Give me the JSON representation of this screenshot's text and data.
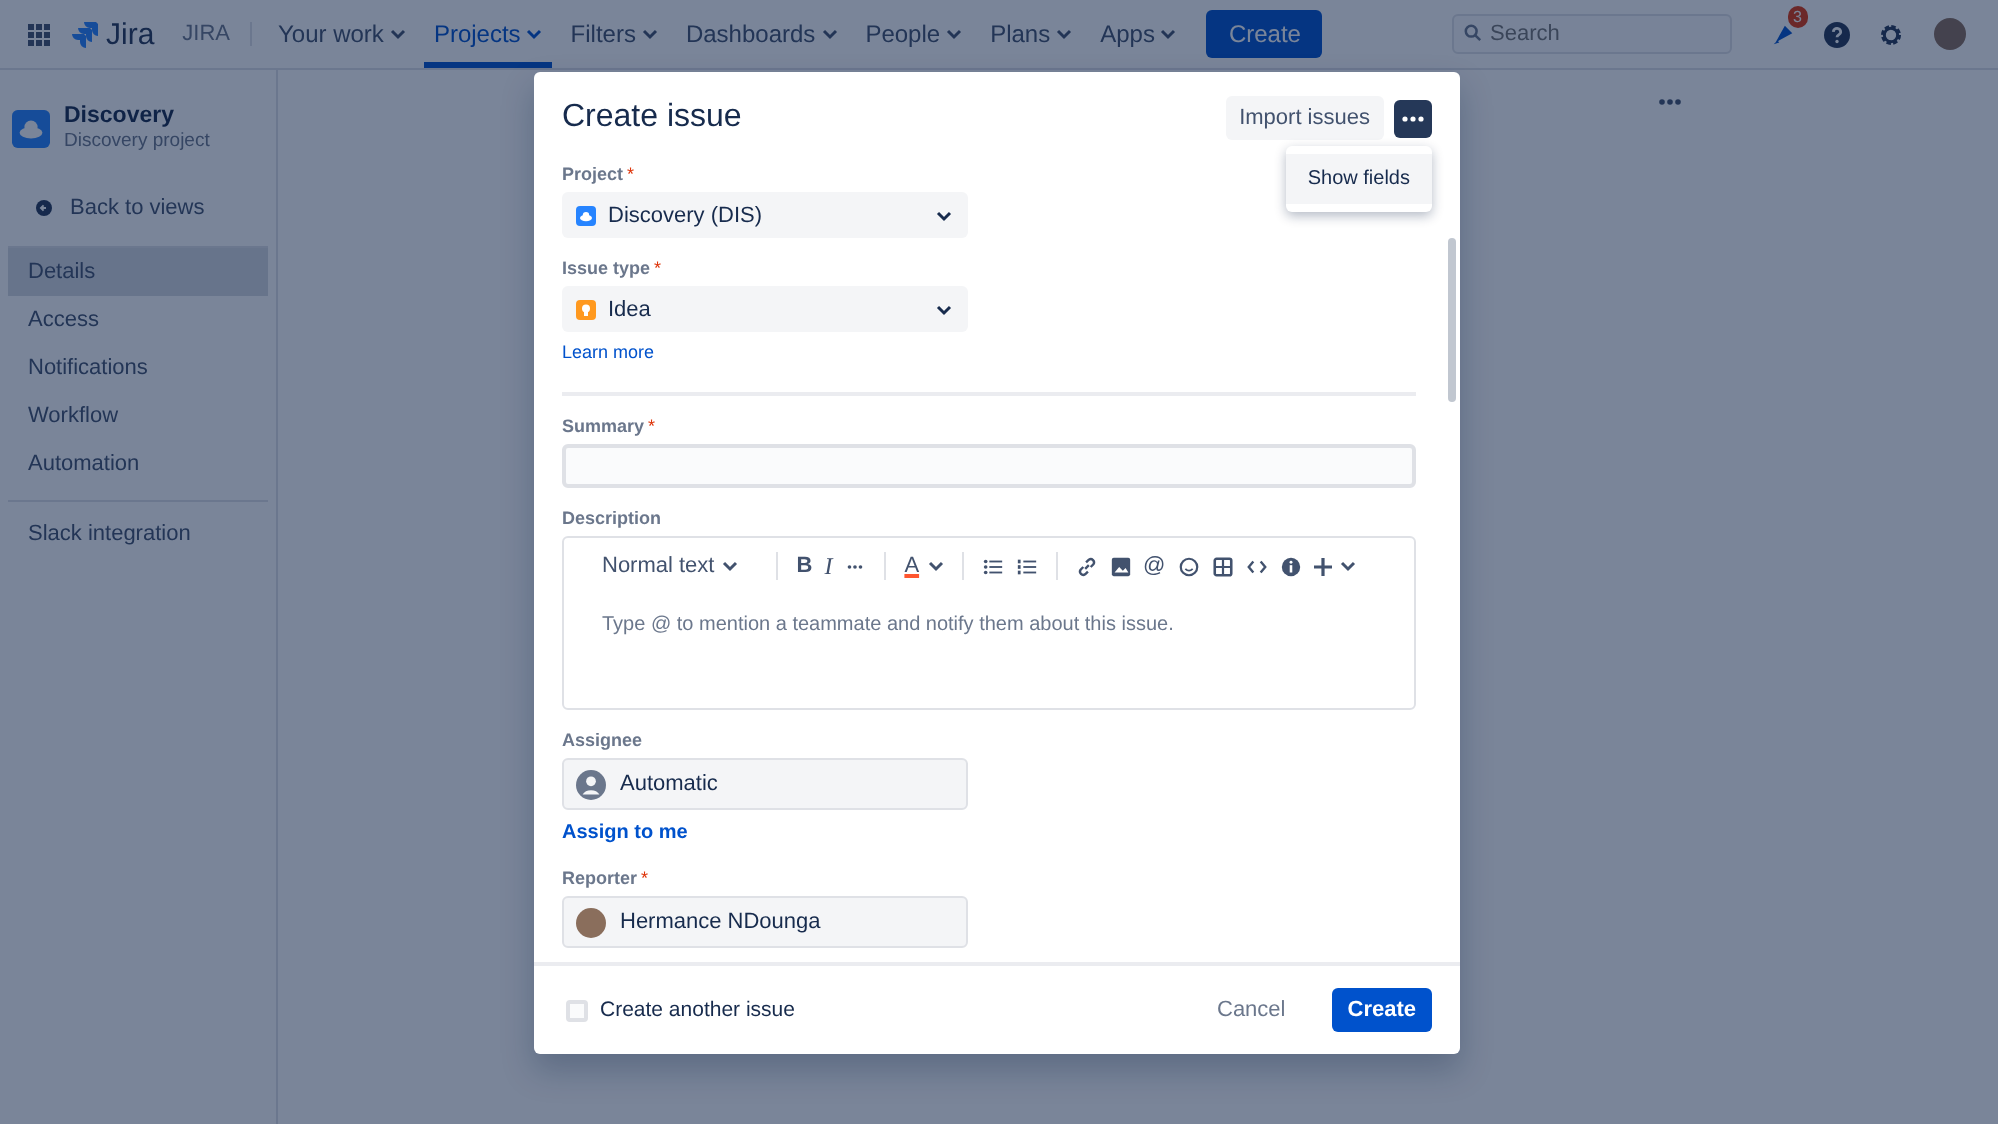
{
  "topbar": {
    "logo": "Jira",
    "product": "JIRA",
    "nav": [
      {
        "label": "Your work",
        "selected": false
      },
      {
        "label": "Projects",
        "selected": true
      },
      {
        "label": "Filters",
        "selected": false
      },
      {
        "label": "Dashboards",
        "selected": false
      },
      {
        "label": "People",
        "selected": false
      },
      {
        "label": "Plans",
        "selected": false
      },
      {
        "label": "Apps",
        "selected": false
      }
    ],
    "create": "Create",
    "search": {
      "placeholder": "Search"
    },
    "notifications_badge": "3"
  },
  "sidebar": {
    "project": {
      "name": "Discovery",
      "subtitle": "Discovery project"
    },
    "back": "Back to views",
    "items": [
      {
        "label": "Details",
        "selected": true
      },
      {
        "label": "Access",
        "selected": false
      },
      {
        "label": "Notifications",
        "selected": false
      },
      {
        "label": "Workflow",
        "selected": false
      },
      {
        "label": "Automation",
        "selected": false
      }
    ],
    "extra_items": [
      "Slack integration"
    ]
  },
  "modal": {
    "title": "Create issue",
    "import_button": "Import issues",
    "more_menu": {
      "expanded": true,
      "items": [
        "Show fields"
      ]
    },
    "fields": [
      {
        "kind": "select",
        "label": "Project",
        "required_mark": "*",
        "value": "Discovery (DIS)"
      },
      {
        "kind": "select",
        "label": "Issue type",
        "required_mark": "*",
        "value": "Idea",
        "link": "Learn more",
        "divider_after": true
      },
      {
        "kind": "text",
        "label": "Summary",
        "required_mark": "*"
      },
      {
        "kind": "editor",
        "label": "Description",
        "placeholder": "Type @ to mention a teammate and notify them about this issue.",
        "toolbar": {
          "style": "Normal text",
          "marks": [
            "B",
            "I"
          ],
          "color_letter": "A",
          "mention": "@"
        }
      },
      {
        "kind": "user",
        "label": "Assignee",
        "value": "Automatic",
        "link": "Assign to me"
      },
      {
        "kind": "user",
        "label": "Reporter",
        "required_mark": "*",
        "value": "Hermance NDounga"
      }
    ],
    "footer": {
      "create_another": {
        "label": "Create another issue",
        "checked": false
      },
      "cancel": "Cancel",
      "create": "Create"
    }
  }
}
